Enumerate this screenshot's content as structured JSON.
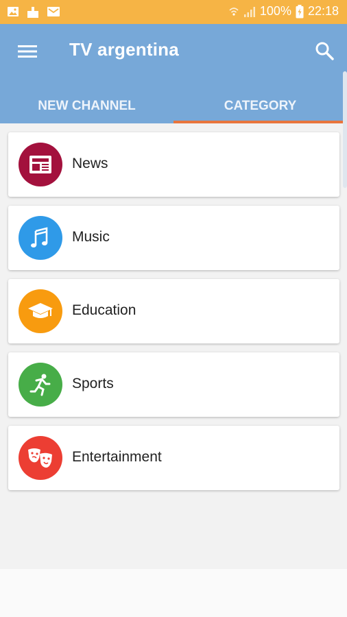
{
  "status_bar": {
    "battery": "100%",
    "time": "22:18",
    "icons": [
      "gallery-icon",
      "notification-icon",
      "mail-icon",
      "wifi-icon",
      "signal-icon",
      "battery-icon"
    ]
  },
  "app_bar": {
    "title": "TV argentina",
    "menu_icon": "hamburger-menu-icon",
    "search_icon": "search-icon",
    "background": "#77a8d8"
  },
  "tabs": [
    {
      "label": "NEW CHANNEL",
      "selected": false
    },
    {
      "label": "CATEGORY",
      "selected": true
    }
  ],
  "tab_indicator_color": "#e8753d",
  "categories": [
    {
      "label": "News",
      "icon": "newspaper-icon",
      "color": "#a3113d"
    },
    {
      "label": "Music",
      "icon": "music-note-icon",
      "color": "#2f9ae8"
    },
    {
      "label": "Education",
      "icon": "graduation-cap-icon",
      "color": "#f89b0f"
    },
    {
      "label": "Sports",
      "icon": "runner-icon",
      "color": "#47ad48"
    },
    {
      "label": "Entertainment",
      "icon": "theater-masks-icon",
      "color": "#ec3e33"
    }
  ]
}
